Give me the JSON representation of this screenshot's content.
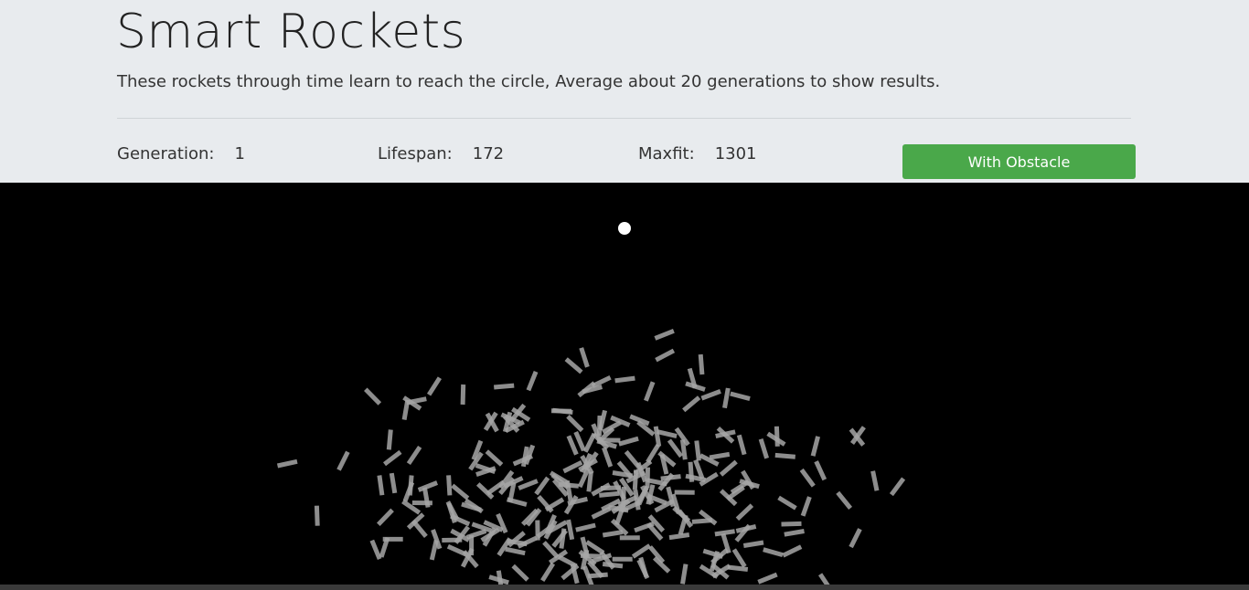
{
  "title": "Smart Rockets",
  "subtitle": "These rockets through time learn to reach the circle, Average about 20 generations to show results.",
  "stats": {
    "generation_label": "Generation:",
    "generation_value": "1",
    "lifespan_label": "Lifespan:",
    "lifespan_value": "172",
    "maxfit_label": "Maxfit:",
    "maxfit_value": "1301"
  },
  "button": {
    "label": "With Obstacle",
    "color": "#4aa84a"
  },
  "canvas": {
    "background": "#000000",
    "target_color": "#ffffff",
    "rocket_color": "#a6a6a6"
  }
}
